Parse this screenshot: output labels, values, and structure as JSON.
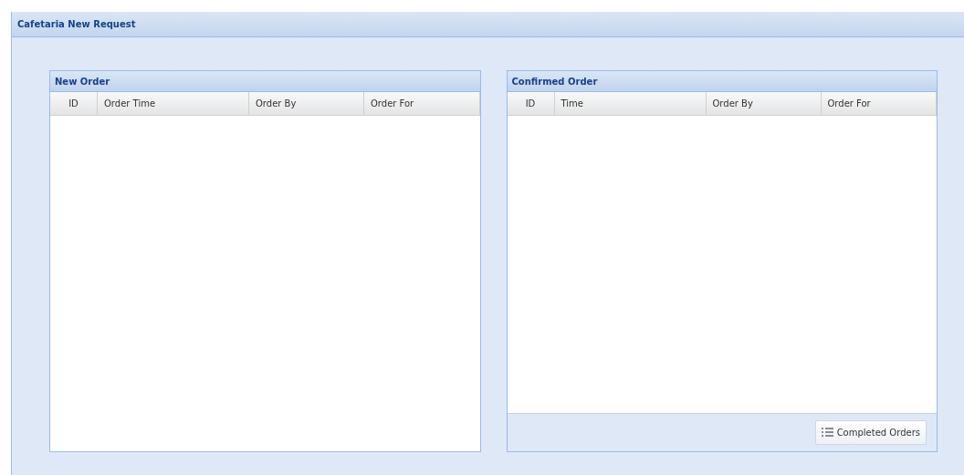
{
  "window": {
    "title": "Cafetaria New Request"
  },
  "panels": [
    {
      "title": "New Order",
      "columns": [
        "ID",
        "Order Time",
        "Order By",
        "Order For"
      ]
    },
    {
      "title": "Confirmed Order",
      "columns": [
        "ID",
        "Time",
        "Order By",
        "Order For"
      ],
      "footer_buttons": [
        "Completed Orders"
      ]
    }
  ]
}
